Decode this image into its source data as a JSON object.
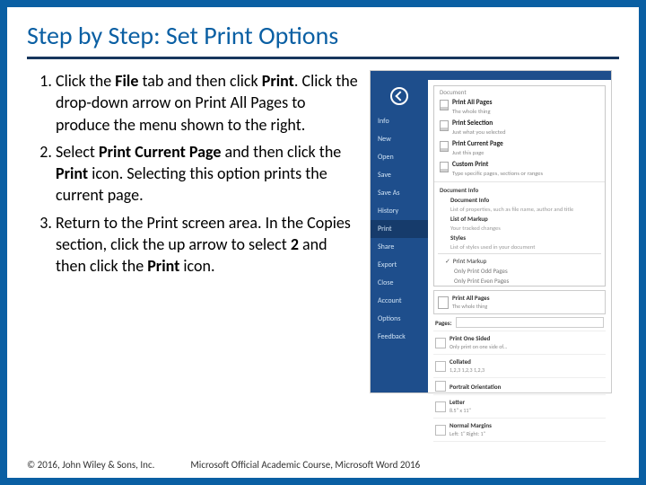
{
  "title": "Step by Step: Set Print Options",
  "steps": [
    {
      "pre": "Click the ",
      "b1": "File",
      "mid1": " tab and then click ",
      "b2": "Print",
      "post": ". Click the drop-down arrow on Print All Pages to produce the menu shown to the right."
    },
    {
      "pre": "Select ",
      "b1": "Print Current Page",
      "mid1": " and then click the ",
      "b2": "Print",
      "post": " icon. Selecting this option prints the current page."
    },
    {
      "pre": "Return to the Print screen area. In the Copies section, click the up arrow to select ",
      "b1": "2",
      "mid1": " and then click the ",
      "b2": "Print",
      "post": " icon."
    }
  ],
  "side": {
    "items": [
      "Info",
      "New",
      "Open",
      "Save",
      "Save As",
      "History",
      "Print",
      "Share",
      "Export",
      "Close",
      "Account",
      "Options",
      "Feedback"
    ],
    "activeIndex": 6
  },
  "menu": {
    "heading": "Document",
    "opts": [
      {
        "title": "Print All Pages",
        "sub": "The whole thing"
      },
      {
        "title": "Print Selection",
        "sub": "Just what you selected"
      },
      {
        "title": "Print Current Page",
        "sub": "Just this page"
      },
      {
        "title": "Custom Print",
        "sub": "Type specific pages, sections or ranges"
      }
    ],
    "section2": "Document Info",
    "info": [
      {
        "t": "Document Info",
        "s": "List of properties, such as file name, author and title"
      },
      {
        "t": "List of Markup",
        "s": "Your tracked changes"
      },
      {
        "t": "Styles",
        "s": "List of styles used in your document"
      }
    ],
    "checks": [
      "Print Markup",
      "Only Print Odd Pages",
      "Only Print Even Pages"
    ]
  },
  "selected": {
    "title": "Print All Pages",
    "sub": "The whole thing"
  },
  "pagesLabel": "Pages:",
  "rows": [
    {
      "t": "Print One Sided",
      "s": "Only print on one side of..."
    },
    {
      "t": "Collated",
      "s": "1,2,3   1,2,3   1,2,3"
    },
    {
      "t": "Portrait Orientation",
      "s": ""
    },
    {
      "t": "Letter",
      "s": "8.5\" x 11\""
    },
    {
      "t": "Normal Margins",
      "s": "Left: 1\"  Right: 1\""
    }
  ],
  "footer": {
    "copyright": "© 2016, John Wiley & Sons, Inc.",
    "course": "Microsoft Official Academic Course, Microsoft Word 2016"
  }
}
